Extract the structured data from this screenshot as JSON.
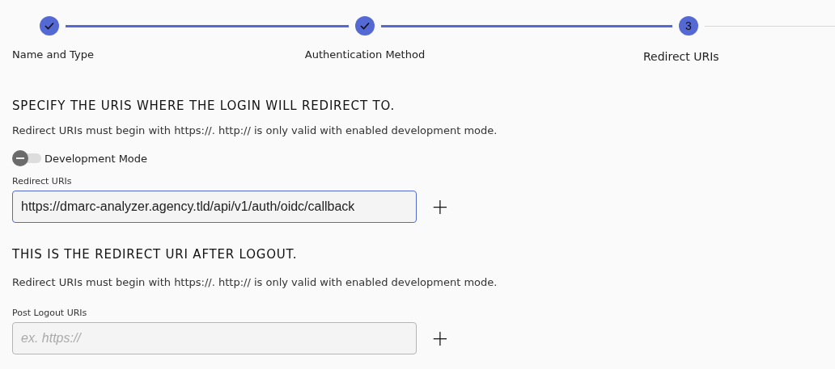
{
  "stepper": {
    "steps": [
      {
        "label": "Name and Type",
        "completed": true,
        "selected": false
      },
      {
        "label": "Authentication Method",
        "completed": true,
        "selected": false
      },
      {
        "label": "Redirect URIs",
        "number": "3",
        "completed": false,
        "selected": true
      }
    ]
  },
  "redirect_section": {
    "heading": "SPECIFY THE URIS WHERE THE LOGIN WILL REDIRECT TO.",
    "description": "Redirect URIs must begin with https://. http:// is only valid with enabled development mode.",
    "toggle": {
      "label": "Development Mode",
      "on": false
    },
    "field": {
      "label": "Redirect URIs",
      "value": "https://dmarc-analyzer.agency.tld/api/v1/auth/oidc/callback",
      "focused": true
    },
    "add_button": "+"
  },
  "logout_section": {
    "heading": "THIS IS THE REDIRECT URI AFTER LOGOUT.",
    "description": "Redirect URIs must begin with https://. http:// is only valid with enabled development mode.",
    "field": {
      "label": "Post Logout URIs",
      "placeholder": "ex. https://",
      "focused": false
    },
    "add_button": "+"
  }
}
